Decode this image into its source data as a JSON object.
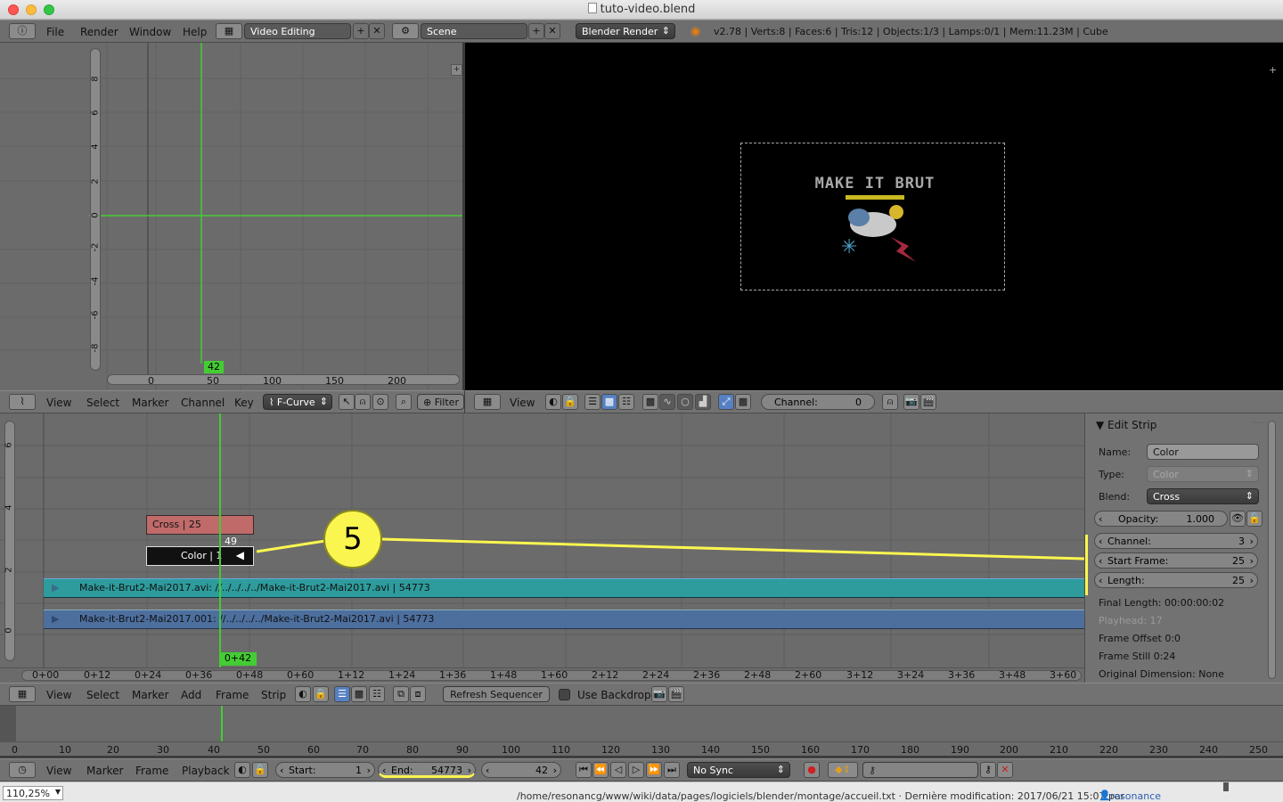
{
  "window": {
    "title": "tuto-video.blend"
  },
  "topbar": {
    "menus": [
      "File",
      "Render",
      "Window",
      "Help"
    ],
    "layout": "Video Editing",
    "scene": "Scene",
    "engine": "Blender Render",
    "stats": "v2.78 | Verts:8 | Faces:6 | Tris:12 | Objects:1/3 | Lamps:0/1 | Mem:11.23M | Cube"
  },
  "graph_editor": {
    "y_ticks": [
      "8",
      "6",
      "4",
      "2",
      "0",
      "-2",
      "-4",
      "-6",
      "-8"
    ],
    "x_ticks": [
      "0",
      "50",
      "100",
      "150",
      "200"
    ],
    "current_frame": "42",
    "menus": [
      "View",
      "Select",
      "Marker",
      "Channel",
      "Key"
    ],
    "mode": "F-Curve",
    "filter": "Filter"
  },
  "preview": {
    "logo_text": "MAKE IT BRUT",
    "menu": "View",
    "channel_label": "Channel:",
    "channel_value": "0"
  },
  "sequencer": {
    "y_ticks": [
      "6",
      "4",
      "2",
      "0"
    ],
    "x_ticks": [
      "0+00",
      "0+12",
      "0+24",
      "0+36",
      "0+48",
      "0+60",
      "1+12",
      "1+24",
      "1+36",
      "1+48",
      "1+60",
      "2+12",
      "2+24",
      "2+36",
      "2+48",
      "2+60",
      "3+12",
      "3+24",
      "3+36",
      "3+48",
      "3+60"
    ],
    "current_frame": "0+42",
    "strips": {
      "cross": "Cross | 25",
      "color": "Color | 1",
      "color_end": "49",
      "movie1": "Make-it-Brut2-Mai2017.avi: //../../../../Make-it-Brut2-Mai2017.avi | 54773",
      "movie2": "Make-it-Brut2-Mai2017.001: //../../../../Make-it-Brut2-Mai2017.avi | 54773"
    },
    "annotation_number": "5",
    "menus": [
      "View",
      "Select",
      "Marker",
      "Add",
      "Frame",
      "Strip"
    ],
    "refresh": "Refresh Sequencer",
    "backdrop": "Use Backdrop"
  },
  "edit_strip": {
    "title": "Edit Strip",
    "name_label": "Name:",
    "name_value": "Color",
    "type_label": "Type:",
    "type_value": "Color",
    "blend_label": "Blend:",
    "blend_value": "Cross",
    "opacity_label": "Opacity:",
    "opacity_value": "1.000",
    "channel_label": "Channel:",
    "channel_value": "3",
    "start_label": "Start Frame:",
    "start_value": "25",
    "length_label": "Length:",
    "length_value": "25",
    "final_length": "Final Length: 00:00:00:02",
    "playhead": "Playhead: 17",
    "frame_offset": "Frame Offset 0:0",
    "frame_still": "Frame Still 0:24",
    "original_dimension": "Original Dimension: None"
  },
  "timeline": {
    "ticks": [
      "0",
      "10",
      "20",
      "30",
      "40",
      "50",
      "60",
      "70",
      "80",
      "90",
      "100",
      "110",
      "120",
      "130",
      "140",
      "150",
      "160",
      "170",
      "180",
      "190",
      "200",
      "210",
      "220",
      "230",
      "240",
      "250"
    ],
    "menus": [
      "View",
      "Marker",
      "Frame",
      "Playback"
    ],
    "start_label": "Start:",
    "start_value": "1",
    "end_label": "End:",
    "end_value": "54773",
    "current": "42",
    "sync": "No Sync"
  },
  "statusbar": {
    "zoom": "110,25%",
    "path": "/home/resonancg/www/wiki/data/pages/logiciels/blender/montage/accueil.txt · Dernière modification: 2017/06/21 15:07 par",
    "user": "resonance"
  },
  "colors": {
    "accent_green": "#44cc33",
    "annotation_yellow": "#fbf64f",
    "strip_teal": "#2e9b9c",
    "strip_blue": "#4d6f9e",
    "strip_cross": "#c06a6a"
  }
}
